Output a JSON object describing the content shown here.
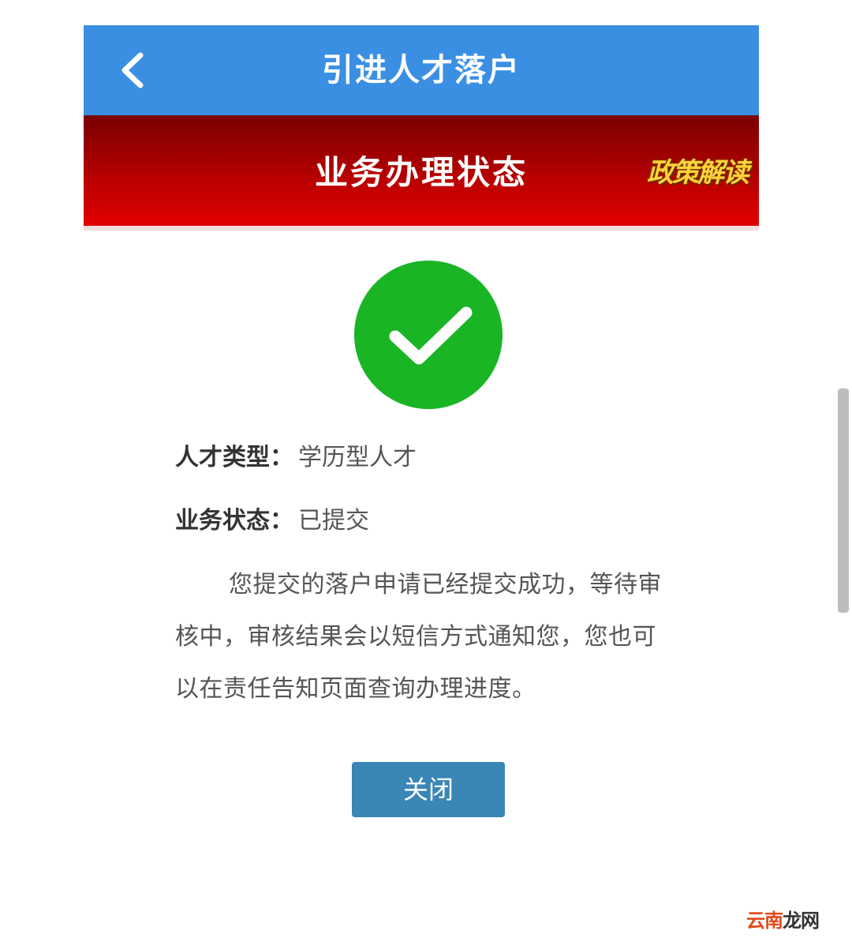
{
  "header": {
    "back_icon": "chevron-left-icon",
    "title": "引进人才落户"
  },
  "banner": {
    "title": "业务办理状态",
    "policy_link": "政策解读"
  },
  "status": {
    "icon": "check-circle-icon",
    "icon_color": "#19b525",
    "talent_type_label": "人才类型：",
    "talent_type_value": "学历型人才",
    "business_status_label": "业务状态：",
    "business_status_value": "已提交",
    "message": "您提交的落户申请已经提交成功，等待审核中，审核结果会以短信方式通知您，您也可以在责任告知页面查询办理进度。"
  },
  "actions": {
    "close_label": "关闭"
  },
  "watermark": {
    "part1": "云南",
    "part2": "龙网"
  },
  "colors": {
    "header_bg": "#3b8fe2",
    "banner_bg": "#c00000",
    "button_bg": "#3a86b6"
  }
}
